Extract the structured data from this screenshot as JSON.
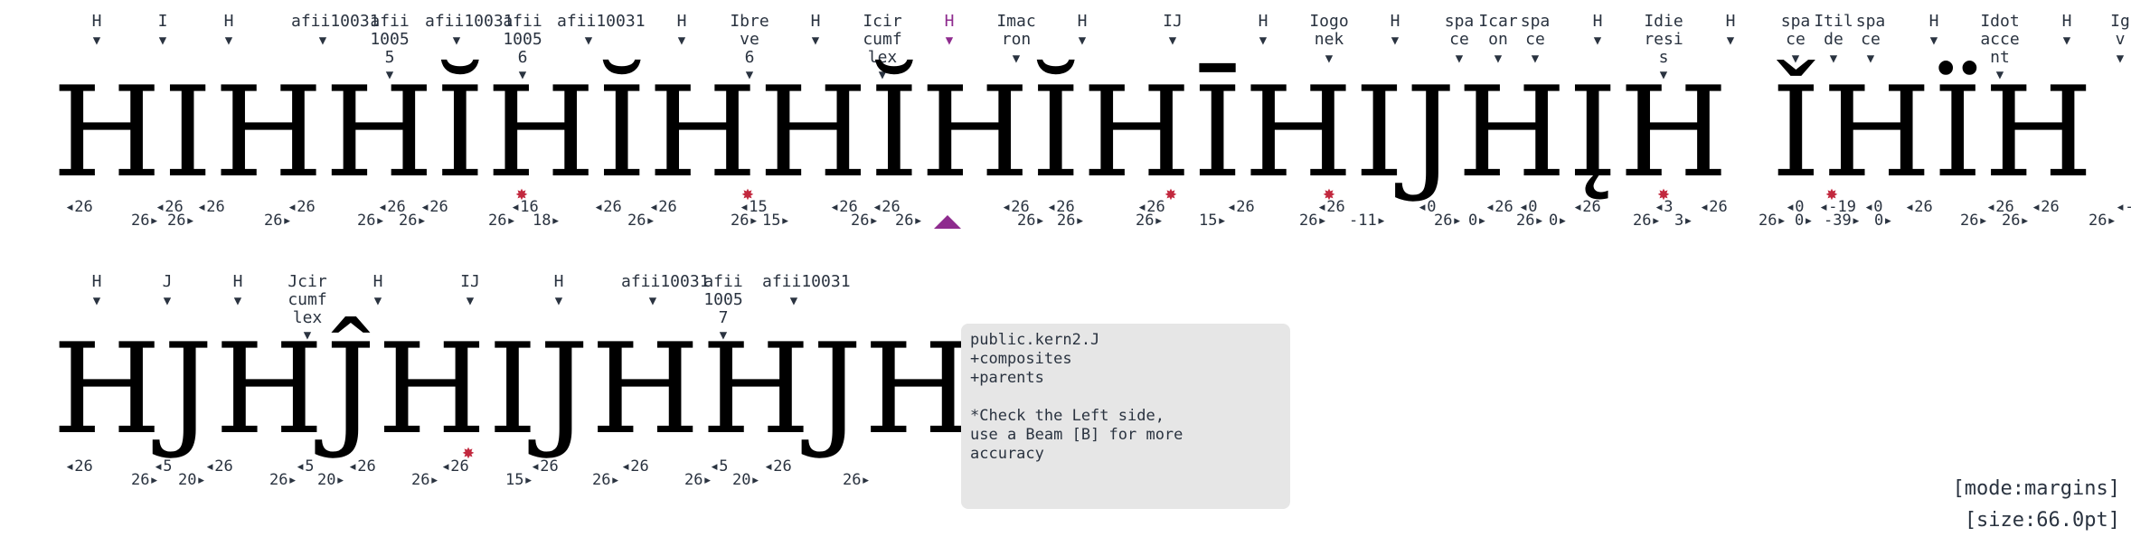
{
  "line1": {
    "text": "HIHHĬHĬHHĬHĬHĪHIJHĮH ǏHÏH ĨHİ",
    "labels": [
      {
        "t": "H"
      },
      {
        "t": "I"
      },
      {
        "t": "H"
      },
      {
        "t": "afii10031"
      },
      {
        "t": "afii\n1005\n5"
      },
      {
        "t": "afii10031"
      },
      {
        "t": "afii\n1005\n6"
      },
      {
        "t": "afii10031"
      },
      {
        "t": "H"
      },
      {
        "t": "Ibre\nve\n6"
      },
      {
        "t": "H"
      },
      {
        "t": "Icir\ncumf\nlex"
      },
      {
        "t": "H",
        "sel": true
      },
      {
        "t": "Imac\nron"
      },
      {
        "t": "H"
      },
      {
        "t": "IJ"
      },
      {
        "t": "H"
      },
      {
        "t": "Iogo\nnek"
      },
      {
        "t": "H"
      },
      {
        "t": "spa\nce"
      },
      {
        "t": "Icar\non"
      },
      {
        "t": "spa\nce"
      },
      {
        "t": "H"
      },
      {
        "t": "Idie\nresi\ns"
      },
      {
        "t": "H"
      },
      {
        "t": "spa\nce"
      },
      {
        "t": "Itil\nde"
      },
      {
        "t": "spa\nce"
      },
      {
        "t": "H"
      },
      {
        "t": "Idot\nacce\nnt"
      },
      {
        "t": "H"
      },
      {
        "t": "Ig\nv"
      }
    ],
    "left_margins": [
      "◂26",
      "◂26",
      "◂26",
      "◂26",
      "◂26",
      "◂26",
      "◂16",
      "◂26",
      "◂26",
      "◂15",
      "◂26",
      "◂26",
      "◂26",
      "◂26",
      "◂26",
      "◂26",
      "◂26",
      "◂0",
      "◂26",
      "◂0",
      "◂26",
      "◂3",
      "◂26",
      "◂0",
      "◂-19",
      "◂0",
      "◂26",
      "◂26",
      "◂26",
      "◂-"
    ],
    "right_margins": [
      "26▸",
      "26▸",
      "26▸",
      "26▸",
      "26▸",
      "26▸",
      "18▸",
      "26▸",
      "26▸",
      "15▸",
      "26▸",
      "26▸",
      "26▸",
      "26▸",
      "26▸",
      "15▸",
      "26▸",
      "-11▸",
      "26▸",
      "0▸",
      "26▸",
      "0▸",
      "26▸",
      "3▸",
      "26▸",
      "0▸",
      "-39▸",
      "0▸",
      "26▸",
      "26▸",
      "26▸"
    ]
  },
  "line2": {
    "text": "HJHĴHIJHHJH",
    "labels": [
      {
        "t": "H"
      },
      {
        "t": "J"
      },
      {
        "t": "H"
      },
      {
        "t": "Jcir\ncumf\nlex"
      },
      {
        "t": "H"
      },
      {
        "t": "IJ"
      },
      {
        "t": "H"
      },
      {
        "t": "afii10031"
      },
      {
        "t": "afii\n1005\n7"
      },
      {
        "t": "afii10031"
      }
    ],
    "left_margins": [
      "◂26",
      "◂5",
      "◂26",
      "◂5",
      "◂26",
      "◂26",
      "◂26",
      "◂26",
      "◂5",
      "◂26"
    ],
    "right_margins": [
      "26▸",
      "20▸",
      "26▸",
      "20▸",
      "26▸",
      "15▸",
      "26▸",
      "26▸",
      "20▸",
      "26▸"
    ]
  },
  "info_panel": {
    "text": "public.kern2.J\n+composites\n+parents\n\n*Check the Left side,\nuse a Beam [B] for more\naccuracy"
  },
  "status": {
    "mode": "[mode:margins]",
    "size": "[size:66.0pt]"
  },
  "colors": {
    "selected": "#8e2b8e",
    "marker_star": "#c2283e",
    "panel_bg": "#e6e6e6"
  }
}
